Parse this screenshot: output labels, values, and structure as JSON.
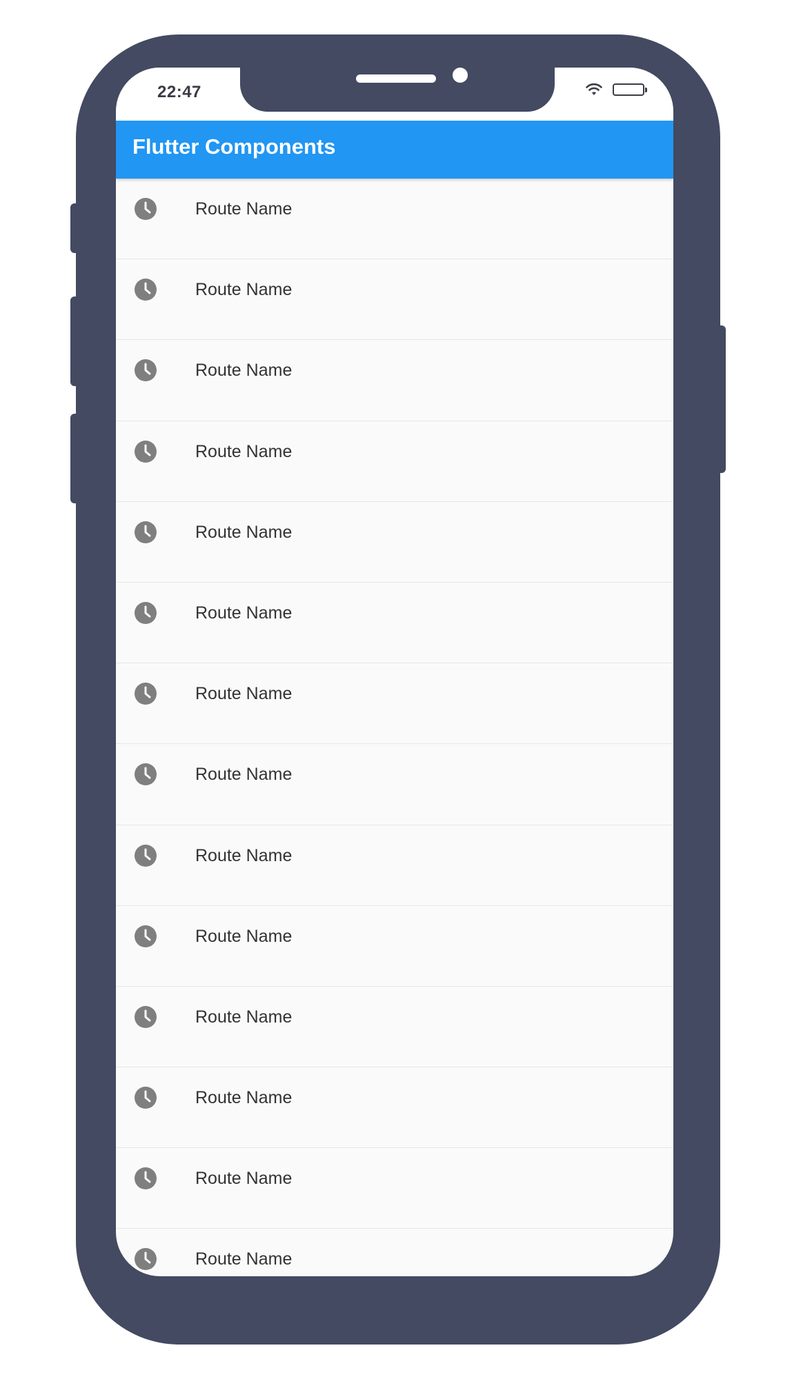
{
  "device": {
    "frame_color": "#434a61"
  },
  "status_bar": {
    "time": "22:47",
    "wifi_icon": "wifi-icon",
    "battery_icon": "battery-icon"
  },
  "app_bar": {
    "title": "Flutter Components",
    "color": "#2196f3"
  },
  "route_list": {
    "icon": "clock-icon",
    "icon_color": "#7f7f7f",
    "items": [
      {
        "label": "Route Name"
      },
      {
        "label": "Route Name"
      },
      {
        "label": "Route Name"
      },
      {
        "label": "Route Name"
      },
      {
        "label": "Route Name"
      },
      {
        "label": "Route Name"
      },
      {
        "label": "Route Name"
      },
      {
        "label": "Route Name"
      },
      {
        "label": "Route Name"
      },
      {
        "label": "Route Name"
      },
      {
        "label": "Route Name"
      },
      {
        "label": "Route Name"
      },
      {
        "label": "Route Name"
      },
      {
        "label": "Route Name"
      }
    ]
  }
}
